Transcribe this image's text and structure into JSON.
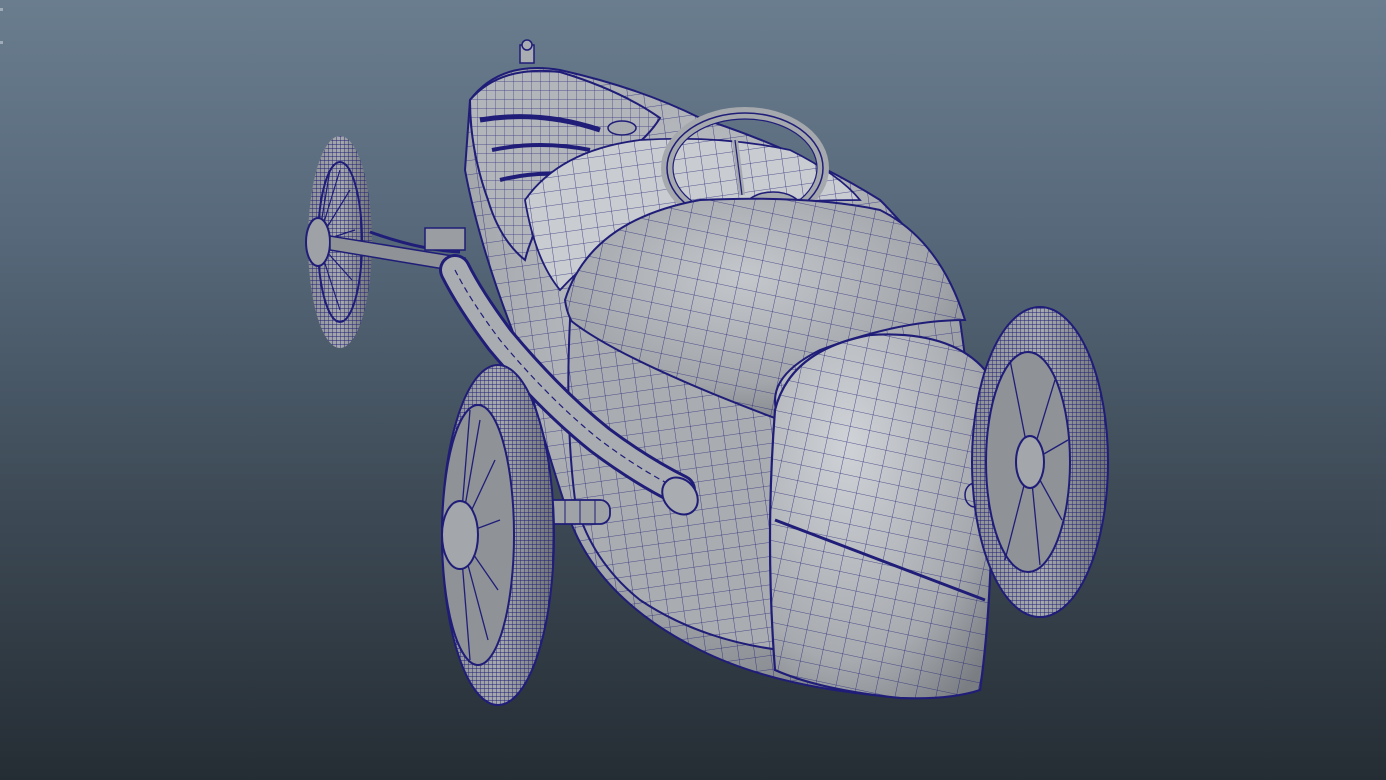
{
  "viewport": {
    "background_top": "#6a7d8e",
    "background_bottom": "#252d34",
    "shading_mode": "wireframe-on-shaded"
  },
  "model": {
    "wire_color": "#1f1d78",
    "surface_color": "#a3a6ab",
    "surface_highlight": "#c4c7cb",
    "surface_shadow": "#6f7378"
  }
}
